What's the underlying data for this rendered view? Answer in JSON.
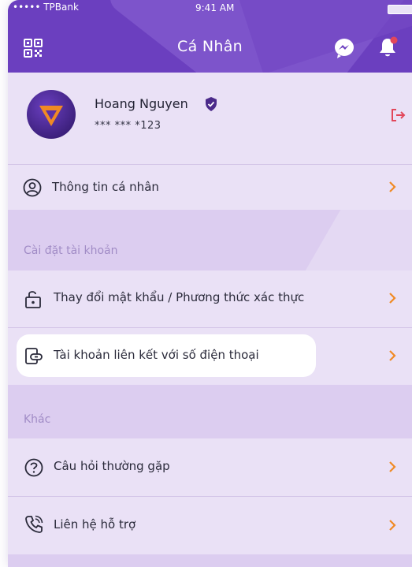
{
  "status_bar": {
    "carrier": "••••• TPBank",
    "time": "9:41 AM"
  },
  "header": {
    "title": "Cá Nhân",
    "qr_icon": "qr-code-icon",
    "messenger_icon": "messenger-icon",
    "bell_icon": "bell-icon"
  },
  "profile": {
    "name": "Hoang Nguyen",
    "account": "*** *** *123",
    "verified_icon": "shield-check-icon",
    "logout_icon": "logout-icon"
  },
  "menu": {
    "personal_info": "Thông tin cá nhân",
    "section_account": "Cài đặt tài khoản",
    "change_password": "Thay đổi mật khẩu / Phương thức xác thực",
    "linked_account": "Tài khoản liên kết với số điện thoại",
    "section_other": "Khác",
    "faq": "Câu hỏi thường gặp",
    "support": "Liên hệ hỗ trợ"
  },
  "colors": {
    "header": "#6b3fbf",
    "accent": "#f08a24",
    "danger": "#e2475b",
    "row_bg": "#eae1f6",
    "section_bg": "#dccdf0"
  }
}
